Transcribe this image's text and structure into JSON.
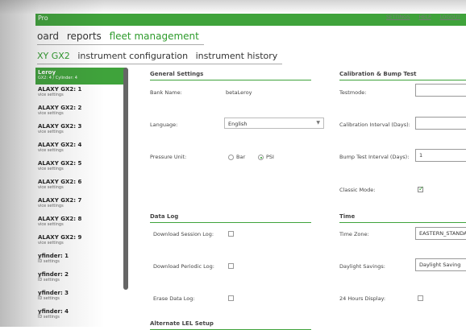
{
  "header": {
    "brand": "Pro",
    "links": [
      "SETTINGS",
      "HELP",
      "LOGOUT"
    ]
  },
  "main_nav": [
    "oard",
    "reports",
    "fleet management"
  ],
  "sub_nav": [
    "XY GX2",
    "instrument configuration",
    "instrument history"
  ],
  "sidebar": {
    "selected": {
      "title": "Leroy",
      "subtitle": "GX2: 4 / Cylinder: 4"
    },
    "items": [
      {
        "title": "ALAXY GX2: 1",
        "subtitle": "vice settings"
      },
      {
        "title": "ALAXY GX2: 2",
        "subtitle": "vice settings"
      },
      {
        "title": "ALAXY GX2: 3",
        "subtitle": "vice settings"
      },
      {
        "title": "ALAXY GX2: 4",
        "subtitle": "vice settings"
      },
      {
        "title": "ALAXY GX2: 5",
        "subtitle": "vice settings"
      },
      {
        "title": "ALAXY GX2: 6",
        "subtitle": "vice settings"
      },
      {
        "title": "ALAXY GX2: 7",
        "subtitle": "vice settings"
      },
      {
        "title": "ALAXY GX2: 8",
        "subtitle": "vice settings"
      },
      {
        "title": "ALAXY GX2: 9",
        "subtitle": "vice settings"
      },
      {
        "title": "yfinder: 1",
        "subtitle": "ID settings"
      },
      {
        "title": "yfinder: 2",
        "subtitle": "ID settings"
      },
      {
        "title": "yfinder: 3",
        "subtitle": "ID settings"
      },
      {
        "title": "yfinder: 4",
        "subtitle": "ID settings"
      }
    ]
  },
  "general": {
    "title": "General Settings",
    "bank_name_label": "Bank Name:",
    "bank_name_value": "betaLeroy",
    "language_label": "Language:",
    "language_value": "English",
    "pressure_label": "Pressure Unit:",
    "pressure_option_bar": "Bar",
    "pressure_option_psi": "PSI"
  },
  "calibration": {
    "title": "Calibration & Bump Test",
    "testmode_label": "Testmode:",
    "testmode_value": "",
    "cal_interval_label": "Calibration Interval (Days):",
    "cal_interval_value": "",
    "bump_interval_label": "Bump Test Interval (Days):",
    "bump_interval_value": "1",
    "classic_label": "Classic Mode:"
  },
  "datalog": {
    "title": "Data Log",
    "session_label": "Download Session Log:",
    "periodic_label": "Download Periodic Log:",
    "erase_label": "Erase Data Log:"
  },
  "time": {
    "title": "Time",
    "zone_label": "Time Zone:",
    "zone_value": "EASTERN_STANDARD",
    "daylight_label": "Daylight Savings:",
    "daylight_value": "Daylight Saving",
    "hours24_label": "24 Hours Display:"
  },
  "alternate": {
    "title": "Alternate LEL Setup"
  },
  "colors": {
    "accent": "#3fa33b",
    "accent_text": "#2e9b2c"
  }
}
